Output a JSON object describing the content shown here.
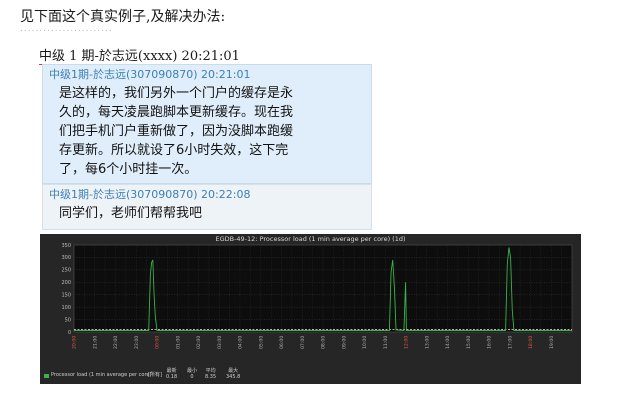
{
  "intro_text": "见下面这个真实例子,及解决办法:",
  "separator": "........................",
  "heading": {
    "sender": "中级 1 期-於志远(xxxx)",
    "time": "20:21:01"
  },
  "messages": [
    {
      "header": "中级1期-於志远(307090870) 20:21:01",
      "lines": [
        "是这样的，我们另外一个门户的缓存是永",
        "久的，每天凌晨跑脚本更新缓存。现在我",
        "们把手机门户重新做了，因为没脚本跑缓",
        "存更新。所以就设了6小时失效，这下完",
        "了，每6个小时挂一次。"
      ]
    },
    {
      "header": "中级1期-於志远(307090870) 20:22:08",
      "lines": [
        "同学们，老师们帮帮我吧"
      ]
    }
  ],
  "chart_data": {
    "type": "line",
    "title": "EGDB-49-12: Processor load (1 min average per core) (1d)",
    "ylim": [
      0,
      350
    ],
    "yticks": [
      0,
      50,
      100,
      150,
      200,
      250,
      300,
      350
    ],
    "xticks": [
      "20:00",
      "21:00",
      "22:00",
      "23:00",
      "00:00",
      "01:00",
      "02:00",
      "03:00",
      "04:00",
      "05:00",
      "06:00",
      "07:00",
      "08:00",
      "09:00",
      "10:00",
      "11:00",
      "12:00",
      "13:00",
      "14:00",
      "15:00",
      "16:00",
      "17:00",
      "18:00",
      "19:00"
    ],
    "xticks_red": [
      "20:00",
      "00:00",
      "12:00",
      "18:00"
    ],
    "series": [
      {
        "name": "Processor load (1 min average per core)",
        "color": "#3bb34a",
        "points": [
          [
            0,
            6
          ],
          [
            3.6,
            6
          ],
          [
            3.68,
            230
          ],
          [
            3.74,
            280
          ],
          [
            3.8,
            290
          ],
          [
            3.86,
            150
          ],
          [
            3.92,
            60
          ],
          [
            4.0,
            6
          ],
          [
            15.2,
            6
          ],
          [
            15.28,
            240
          ],
          [
            15.36,
            290
          ],
          [
            15.44,
            180
          ],
          [
            15.52,
            8
          ],
          [
            15.9,
            6
          ],
          [
            15.98,
            200
          ],
          [
            16.02,
            6
          ],
          [
            20.8,
            6
          ],
          [
            20.88,
            270
          ],
          [
            20.96,
            340
          ],
          [
            21.04,
            300
          ],
          [
            21.12,
            90
          ],
          [
            21.2,
            6
          ],
          [
            24,
            6
          ]
        ]
      }
    ],
    "threshold": {
      "value": 10,
      "color": "#e8e8e8"
    },
    "legend": {
      "entry": "Processor load (1 min average per core)",
      "stat_label": "[所有]",
      "stat_headers": [
        "最新",
        "最小",
        "平均",
        "最大"
      ],
      "stat_values": [
        "0.18",
        "0",
        "8.35",
        "345.8"
      ]
    }
  }
}
